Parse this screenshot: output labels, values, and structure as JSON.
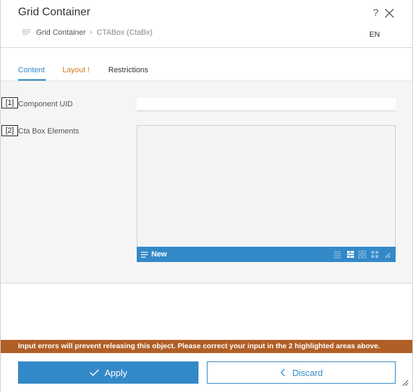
{
  "dialog": {
    "title": "Grid Container",
    "language": "EN",
    "breadcrumb": [
      "Grid Container",
      "CTABox (CtaBx)"
    ]
  },
  "tabs": [
    {
      "label": "Content",
      "state": "active"
    },
    {
      "label": "Layout !",
      "state": "error"
    },
    {
      "label": "Restrictions",
      "state": "normal"
    }
  ],
  "fields": [
    {
      "marker": "[1]",
      "label": "Component UID",
      "value": ""
    },
    {
      "marker": "[2]",
      "label": "Cta Box Elements"
    }
  ],
  "list_toolbar": {
    "new_label": "New"
  },
  "error_message": "Input errors will prevent releasing this object. Please correct your input in the 2 highlighted areas above.",
  "buttons": {
    "apply_label": "Apply",
    "discard_label": "Discard"
  },
  "colors": {
    "accent": "#3389c8",
    "error": "#b05f26",
    "tab_warning": "#d07a24"
  },
  "icons": [
    "help-icon",
    "close-icon",
    "breadcrumb-menu-icon",
    "list-new-icon",
    "list-view-icon",
    "tree-view-icon",
    "grid-view-icon",
    "tiles-view-icon",
    "resize-icon",
    "check-icon",
    "chevron-left-icon",
    "dialog-resize-grip-icon"
  ]
}
